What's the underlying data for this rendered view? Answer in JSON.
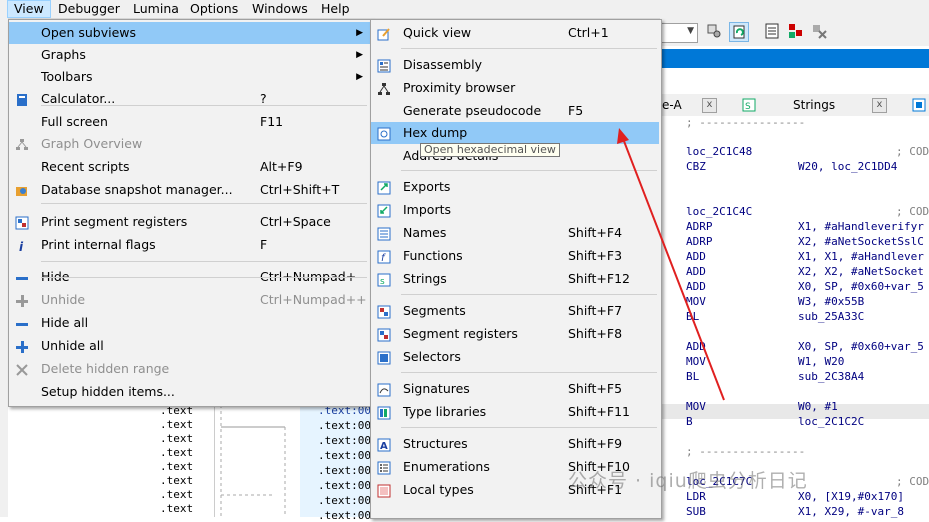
{
  "menubar": {
    "items": [
      {
        "label": "View",
        "active": true
      },
      {
        "label": "Debugger"
      },
      {
        "label": "Lumina"
      },
      {
        "label": "Options"
      },
      {
        "label": "Windows"
      },
      {
        "label": "Help"
      }
    ]
  },
  "tabs": {
    "tab_a": "e-A",
    "strings": "Strings",
    "close": "x"
  },
  "segments": [
    ".text",
    ".text",
    ".text",
    ".text",
    ".text",
    ".text",
    ".text",
    ".text"
  ],
  "segments2": [
    ".text:00",
    ".text:00",
    ".text:00",
    ".text:00",
    ".text:00",
    ".text:00",
    ".text:00",
    ".text:00"
  ],
  "disasm": [
    {
      "a": "; ----------------"
    },
    {
      "a": "loc_2C1C48",
      "b": "; COD"
    },
    {
      "a": "CBZ",
      "b": "W20, loc_2C1DD4"
    },
    {
      "a": "loc_2C1C4C",
      "b": "; COD"
    },
    {
      "a": "ADRP",
      "b": "X1, #aHandleverifyr"
    },
    {
      "a": "ADRP",
      "b": "X2, #aNetSocketSslC"
    },
    {
      "a": "ADD",
      "b": "X1, X1, #aHandlever"
    },
    {
      "a": "ADD",
      "b": "X2, X2, #aNetSocket"
    },
    {
      "a": "ADD",
      "b": "X0, SP, #0x60+var_5"
    },
    {
      "a": "MOV",
      "b": "W3, #0x55B"
    },
    {
      "a": "BL",
      "b": "sub_25A33C"
    },
    {
      "a": "ADD",
      "b": "X0, SP, #0x60+var_5"
    },
    {
      "a": "MOV",
      "b": "W1, W20"
    },
    {
      "a": "BL",
      "b": "sub_2C38A4"
    },
    {
      "a": "MOV",
      "b": "W0, #1"
    },
    {
      "a": "B",
      "b": "loc_2C1C2C"
    },
    {
      "a": "; ----------------"
    },
    {
      "a": "loc_2C1C7C",
      "b": "; COD"
    },
    {
      "a": "LDR",
      "b": "X0, [X19,#0x170]"
    },
    {
      "a": "SUB",
      "b": "X1, X29, #-var_8"
    }
  ],
  "view_menu": {
    "items": [
      {
        "label": "Open subviews",
        "shortcut": "",
        "submenu": true,
        "icon": "none"
      },
      {
        "label": "Graphs",
        "shortcut": "",
        "submenu": true,
        "icon": "none"
      },
      {
        "label": "Toolbars",
        "shortcut": "",
        "submenu": true,
        "icon": "none"
      },
      {
        "label": "Calculator...",
        "shortcut": "?",
        "icon": "calculator-icon"
      },
      {
        "label": "Full screen",
        "shortcut": "F11",
        "icon": "none"
      },
      {
        "label": "Graph Overview",
        "shortcut": "",
        "icon": "graph-overview-icon",
        "disabled": true
      },
      {
        "label": "Recent scripts",
        "shortcut": "Alt+F9",
        "icon": "none"
      },
      {
        "label": "Database snapshot manager...",
        "shortcut": "Ctrl+Shift+T",
        "icon": "snapshot-icon"
      },
      {
        "label": "Print segment registers",
        "shortcut": "Ctrl+Space",
        "icon": "segment-registers-icon"
      },
      {
        "label": "Print internal flags",
        "shortcut": "F",
        "icon": "info-icon"
      },
      {
        "label": "Hide",
        "shortcut": "Ctrl+Numpad+-",
        "icon": "minus-icon"
      },
      {
        "label": "Unhide",
        "shortcut": "Ctrl+Numpad++",
        "icon": "plus-icon",
        "disabled": true
      },
      {
        "label": "Hide all",
        "shortcut": "",
        "icon": "minus-icon"
      },
      {
        "label": "Unhide all",
        "shortcut": "",
        "icon": "plus-icon"
      },
      {
        "label": "Delete hidden range",
        "shortcut": "",
        "icon": "x-icon",
        "disabled": true
      },
      {
        "label": "Setup hidden items...",
        "shortcut": "",
        "icon": "none"
      }
    ]
  },
  "subviews_menu": {
    "items": [
      {
        "label": "Quick view",
        "shortcut": "Ctrl+1",
        "icon": "quick-view-icon"
      },
      {
        "label": "Disassembly",
        "shortcut": "",
        "icon": "disassembly-icon"
      },
      {
        "label": "Proximity browser",
        "shortcut": "",
        "icon": "proximity-icon"
      },
      {
        "label": "Generate pseudocode",
        "shortcut": "F5",
        "icon": "none"
      },
      {
        "label": "Hex dump",
        "shortcut": "",
        "icon": "hex-dump-icon",
        "highlighted": true
      },
      {
        "label": "Address details",
        "shortcut": "",
        "icon": "none"
      },
      {
        "label": "Exports",
        "shortcut": "",
        "icon": "exports-icon"
      },
      {
        "label": "Imports",
        "shortcut": "",
        "icon": "imports-icon"
      },
      {
        "label": "Names",
        "shortcut": "Shift+F4",
        "icon": "names-icon"
      },
      {
        "label": "Functions",
        "shortcut": "Shift+F3",
        "icon": "functions-icon"
      },
      {
        "label": "Strings",
        "shortcut": "Shift+F12",
        "icon": "strings-icon"
      },
      {
        "label": "Segments",
        "shortcut": "Shift+F7",
        "icon": "segments-icon"
      },
      {
        "label": "Segment registers",
        "shortcut": "Shift+F8",
        "icon": "segment-registers-icon"
      },
      {
        "label": "Selectors",
        "shortcut": "",
        "icon": "selectors-icon"
      },
      {
        "label": "Signatures",
        "shortcut": "Shift+F5",
        "icon": "signatures-icon"
      },
      {
        "label": "Type libraries",
        "shortcut": "Shift+F11",
        "icon": "type-libraries-icon"
      },
      {
        "label": "Structures",
        "shortcut": "Shift+F9",
        "icon": "structures-icon"
      },
      {
        "label": "Enumerations",
        "shortcut": "Shift+F10",
        "icon": "enumerations-icon"
      },
      {
        "label": "Local types",
        "shortcut": "Shift+F1",
        "icon": "local-types-icon"
      }
    ],
    "tooltip": "Open hexadecimal view"
  },
  "watermark": "公众号 · iqiu爬虫分析日记",
  "colors": {
    "accent": "#0078d7",
    "highlight": "#91c9f7",
    "arrow": "#e02020"
  }
}
